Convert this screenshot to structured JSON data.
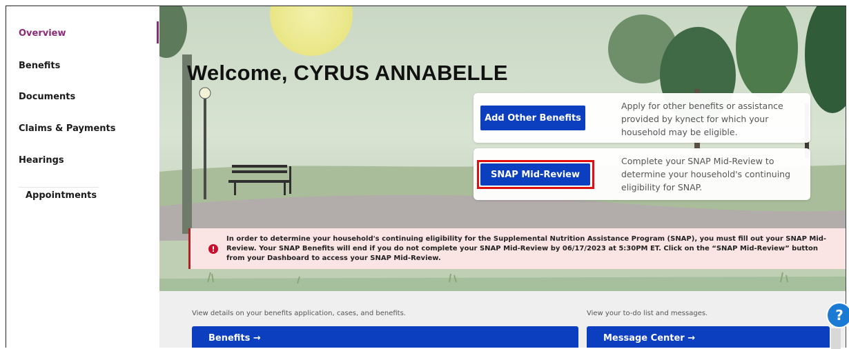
{
  "sidebar": {
    "items": [
      {
        "label": "Overview",
        "active": true
      },
      {
        "label": "Benefits",
        "active": false
      },
      {
        "label": "Documents",
        "active": false
      },
      {
        "label": "Claims & Payments",
        "active": false
      },
      {
        "label": "Hearings",
        "active": false
      },
      {
        "label": "Appointments",
        "active": false
      }
    ]
  },
  "hero": {
    "welcome": "Welcome, CYRUS ANNABELLE",
    "cards": [
      {
        "button": "Add Other Benefits",
        "text": "Apply for other benefits or assistance provided by kynect for which your household may be eligible."
      },
      {
        "button": "SNAP Mid-Review",
        "text": "Complete your SNAP Mid-Review to determine your household's continuing eligibility for SNAP."
      }
    ],
    "alert": {
      "icon": "exclamation-icon",
      "text": "In order to determine your household's continuing eligibility for the Supplemental  Nutrition Assistance Program (SNAP), you must fill out your SNAP Mid-Review.  Your SNAP Benefits will end if you do not complete your SNAP Mid-Review by 06/17/2023 at 5:30PM ET. Click on the “SNAP Mid-Review” button from your Dashboard to access your SNAP Mid-Review."
    }
  },
  "lower": {
    "left_caption": "View details on your benefits application, cases, and benefits.",
    "right_caption": "View your to-do list and messages.",
    "benefits_tile": "Benefits →",
    "messages_tile": "Message Center →"
  },
  "help": {
    "label": "?"
  },
  "colors": {
    "accent": "#8a2a7a",
    "primary": "#0b3fbf",
    "alert_bg": "#fbe4e4",
    "alert_red": "#c8102e"
  }
}
